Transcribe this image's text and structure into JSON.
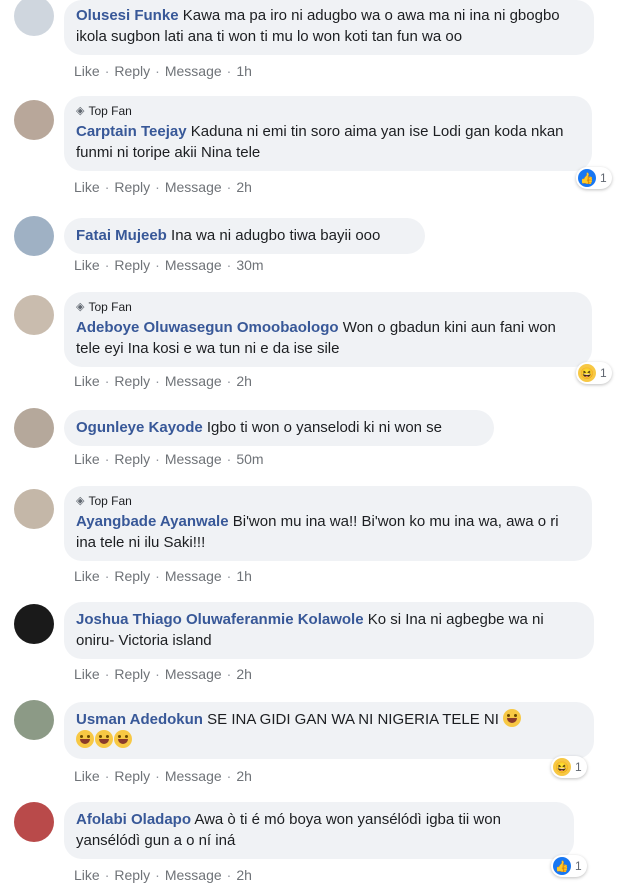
{
  "actions": {
    "like": "Like",
    "reply": "Reply",
    "message": "Message",
    "sep": "·"
  },
  "top_fan_label": "Top Fan",
  "comments": [
    {
      "name": "Olusesi Funke",
      "text": "Kawa ma pa iro ni adugbo wa o awa ma ni ina ni gbogbo ikola sugbon lati ana ti won ti mu lo won koti tan fun wa oo",
      "time": "1h"
    },
    {
      "name": "Carptain Teejay",
      "text": "Kaduna ni emi tin soro aima yan ise Lodi gan koda nkan funmi ni toripe akii Nina tele",
      "time": "2h",
      "reaction_count": "1"
    },
    {
      "name": "Fatai Mujeeb",
      "text": "Ina wa ni adugbo tiwa bayii ooo",
      "time": "30m"
    },
    {
      "name": "Adeboye Oluwasegun Omoobaologo",
      "text": "Won o gbadun kini aun fani won tele eyi Ina kosi e wa tun ni e da ise sile",
      "time": "2h",
      "reaction_count": "1"
    },
    {
      "name": "Ogunleye Kayode",
      "text": "Igbo ti won o yanselodi ki ni won se",
      "time": "50m"
    },
    {
      "name": "Ayangbade Ayanwale",
      "text": "Bi'won mu ina wa!! Bi'won ko mu ina wa, awa o ri ina tele ni ilu Saki!!!",
      "time": "1h"
    },
    {
      "name": "Joshua Thiago Oluwaferanmie Kolawole",
      "text": "Ko si Ina ni agbegbe wa ni oniru- Victoria island",
      "time": "2h"
    },
    {
      "name": "Usman Adedokun",
      "text": "SE INA GIDI GAN WA NI NIGERIA TELE NI",
      "time": "2h",
      "reaction_count": "1"
    },
    {
      "name": "Afolabi Oladapo",
      "text": "Awa ò ti é mó boya won yansélódì igba tii won yansélódì gun a o ní iná",
      "time": "2h",
      "reaction_count": "1"
    }
  ]
}
